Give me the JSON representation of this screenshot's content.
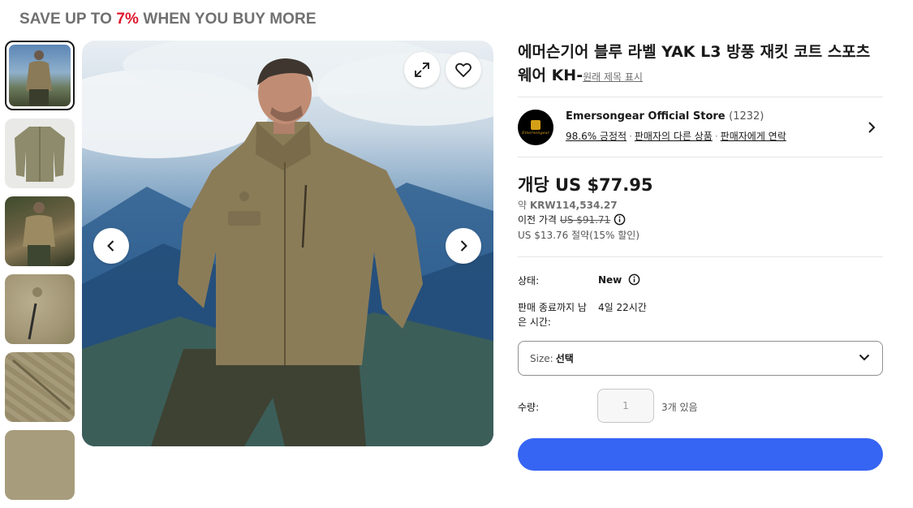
{
  "promo": {
    "prefix": "SAVE UP TO ",
    "percent": "7%",
    "suffix": " WHEN YOU BUY MORE"
  },
  "product": {
    "title": "에머슨기어 블루 라벨 YAK L3 방풍 재킷 코트 스포츠 웨어 KH-",
    "show_original_title": "원래 제목 표시"
  },
  "seller": {
    "name": "Emersongear Official Store",
    "count": "(1232)",
    "feedback": "98.6% 긍정적",
    "other_items": "판매자의 다른 상품",
    "contact": "판매자에게 연락",
    "logo_text": "Emersongear"
  },
  "price": {
    "main": "개당 US $77.95",
    "approx_prefix": "약 ",
    "approx_value": "KRW114,534.27",
    "prev_label": "이전 가격",
    "prev_value": "US $91.71",
    "savings": "US $13.76 절약(15% 할인)"
  },
  "details": {
    "condition_label": "상태:",
    "condition_value": "New",
    "time_label": "판매 종료까지 남은 시간:",
    "time_value": "4일 22시간",
    "size_label": "Size:",
    "size_value": "선택",
    "qty_label": "수량:",
    "qty_value": "1",
    "available": "3개 있음"
  },
  "icons": {
    "expand": "expand-icon",
    "heart": "heart-icon",
    "prev": "chevron-left-icon",
    "next": "chevron-right-icon",
    "info": "info-icon",
    "dropdown": "chevron-down-icon"
  },
  "colors": {
    "promo_accent": "#e0182d",
    "buy_button": "#3665f3"
  }
}
